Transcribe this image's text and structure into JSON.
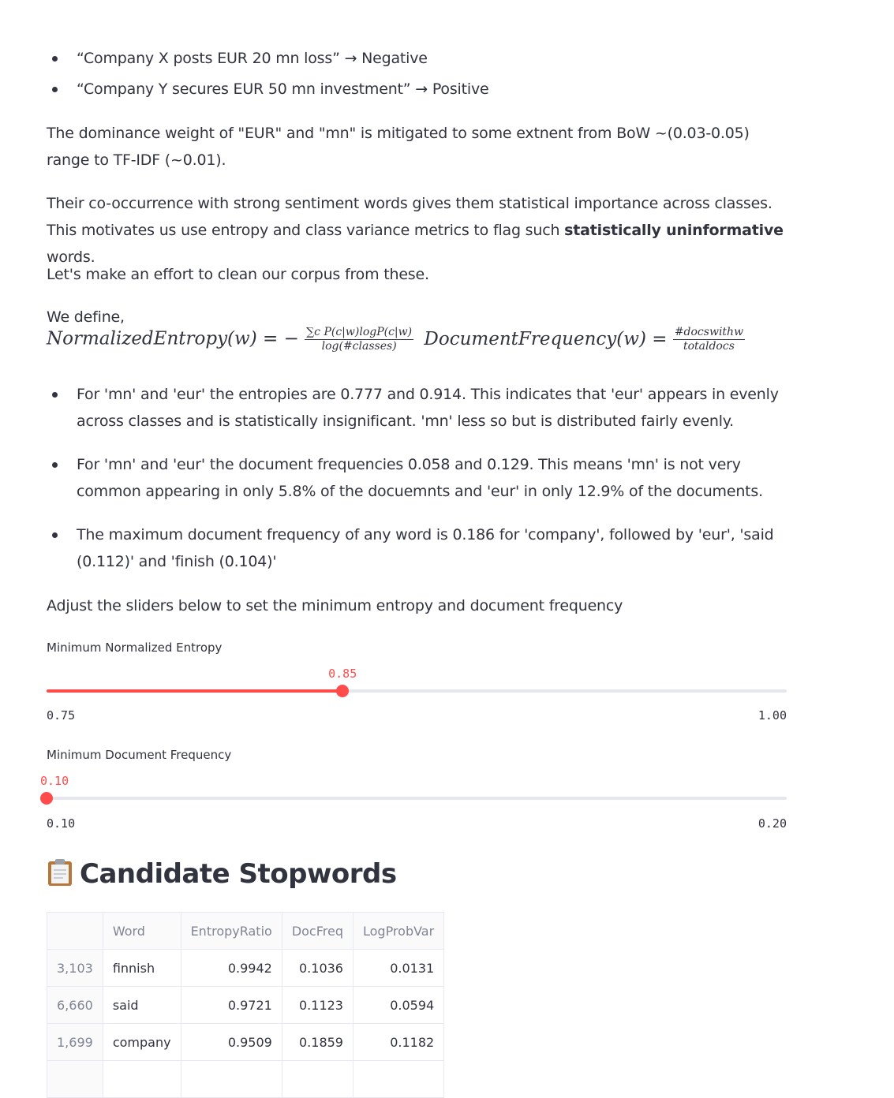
{
  "bullets_top": [
    "“Company X posts EUR 20 mn loss” → Negative",
    "“Company Y secures EUR 50 mn investment” → Positive"
  ],
  "para1": "The dominance weight of \"EUR\" and \"mn\" is mitigated to some extnent from BoW ~(0.03-0.05) range to TF-IDF (~0.01).",
  "para2_pre": "Their co-occurrence with strong sentiment words gives them statistical importance across classes. This motivates us use entropy and class variance metrics to flag such ",
  "para2_bold": "statistically uninformative",
  "para2_post": " words.",
  "para3": "Let's make an effort to clean our corpus from these.",
  "define_label": "We define,",
  "formula": {
    "entropy_lhs": "NormalizedEntropy(w) = −",
    "entropy_num": "∑c P(c|w)logP(c|w)",
    "entropy_den": "log(#classes)",
    "freq_lhs": "DocumentFrequency(w) =",
    "freq_num": "#docswithw",
    "freq_den": "totaldocs"
  },
  "bullets_findings": [
    "For 'mn' and 'eur' the entropies are 0.777 and 0.914. This indicates that 'eur' appears in evenly across classes and is statistically insignificant. 'mn' less so but is distributed fairly evenly.",
    "For 'mn' and 'eur' the document frequencies 0.058 and 0.129. This means 'mn' is not very common appearing in only 5.8% of the docuemnts and 'eur' in only 12.9% of the documents.",
    "The maximum document frequency of any word is 0.186 for 'company', followed by 'eur', 'said (0.112)' and 'finish (0.104)'"
  ],
  "slider_intro": "Adjust the sliders below to set the minimum entropy and document frequency",
  "sliders": {
    "entropy": {
      "label": "Minimum Normalized Entropy",
      "value": "0.85",
      "min": "0.75",
      "max": "1.00",
      "fraction": 0.4
    },
    "docfreq": {
      "label": "Minimum Document Frequency",
      "value": "0.10",
      "min": "0.10",
      "max": "0.20",
      "fraction": 0.0
    }
  },
  "colors": {
    "accent": "#ff4b4b",
    "text": "#31333f",
    "muted": "#808495"
  },
  "section_icon": "clipboard-icon",
  "section_title": "Candidate Stopwords",
  "table": {
    "columns": [
      "",
      "Word",
      "EntropyRatio",
      "DocFreq",
      "LogProbVar"
    ],
    "rows": [
      {
        "index": "3,103",
        "word": "finnish",
        "entropy": "0.9942",
        "docfreq": "0.1036",
        "logprobvar": "0.0131"
      },
      {
        "index": "6,660",
        "word": "said",
        "entropy": "0.9721",
        "docfreq": "0.1123",
        "logprobvar": "0.0594"
      },
      {
        "index": "1,699",
        "word": "company",
        "entropy": "0.9509",
        "docfreq": "0.1859",
        "logprobvar": "0.1182"
      }
    ]
  }
}
